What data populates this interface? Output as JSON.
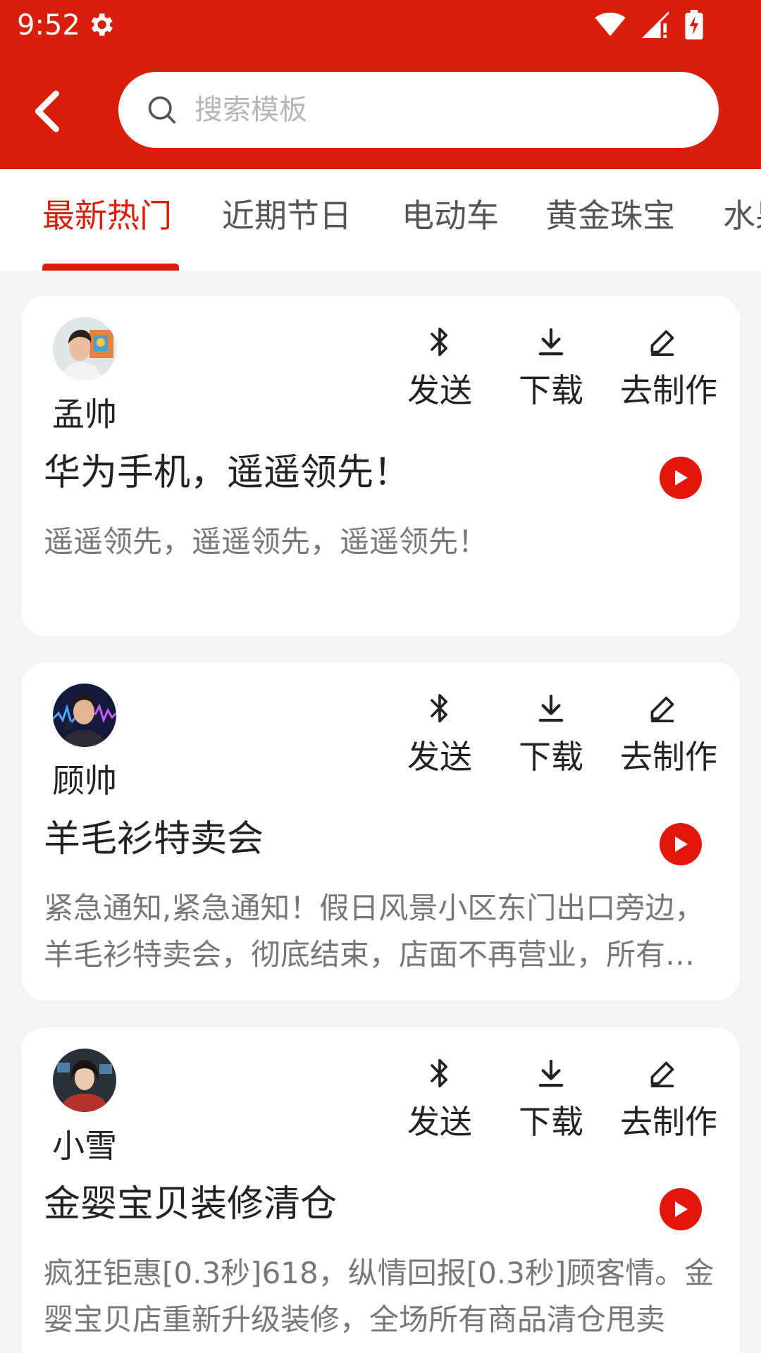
{
  "status": {
    "time": "9:52"
  },
  "search": {
    "placeholder": "搜索模板"
  },
  "tabs": [
    "最新热门",
    "近期节日",
    "电动车",
    "黄金珠宝",
    "水果"
  ],
  "actions": {
    "send": "发送",
    "download": "下载",
    "make": "去制作"
  },
  "cards": [
    {
      "author": "孟帅",
      "title": "华为手机，遥遥领先！",
      "desc": "遥遥领先，遥遥领先，遥遥领先！"
    },
    {
      "author": "顾帅",
      "title": "羊毛衫特卖会",
      "desc": "紧急通知,紧急通知！假日风景小区东门出口旁边，羊毛衫特卖会，彻底结束，店面不再营业，所有商品清仓处理"
    },
    {
      "author": "小雪",
      "title": "金婴宝贝装修清仓",
      "desc": "疯狂钜惠[0.3秒]618，纵情回报[0.3秒]顾客情。金婴宝贝店重新升级装修，全场所有商品清仓甩卖"
    }
  ],
  "colors": {
    "brand": "#d91e0b",
    "play": "#e3160b"
  }
}
